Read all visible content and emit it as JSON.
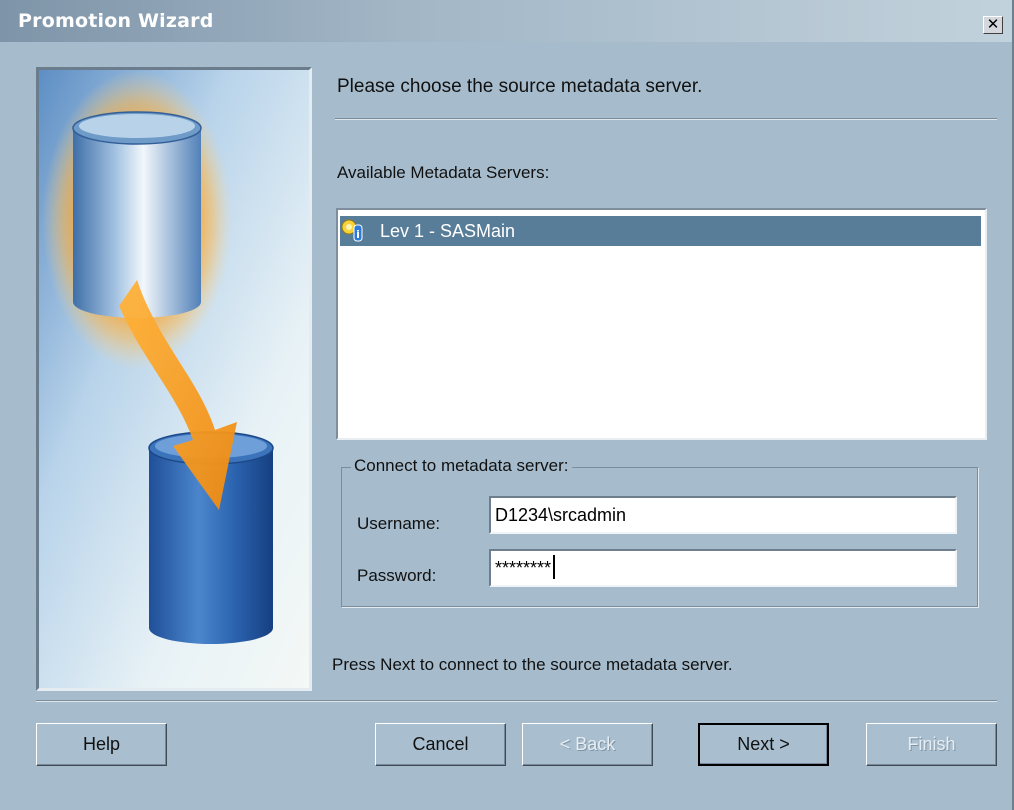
{
  "window": {
    "title": "Promotion Wizard",
    "close_icon": "close-icon",
    "colors": {
      "background": "#a6bccc",
      "selection": "#587d98"
    }
  },
  "illustration": {
    "name": "source-to-target-database-icon"
  },
  "main": {
    "heading": "Please choose the source metadata server.",
    "servers_label": "Available Metadata Servers:",
    "servers": [
      {
        "label": "Lev 1 - SASMain",
        "icon": "metadata-server-icon",
        "selected": true
      }
    ],
    "connect": {
      "legend": "Connect to metadata server:",
      "username_label": "Username:",
      "username_value": "D1234\\srcadmin",
      "password_label": "Password:",
      "password_value": "********"
    },
    "instruction": "Press Next to connect to the source metadata server."
  },
  "buttons": {
    "help": "Help",
    "cancel": "Cancel",
    "back": "< Back",
    "next": "Next >",
    "finish": "Finish"
  }
}
